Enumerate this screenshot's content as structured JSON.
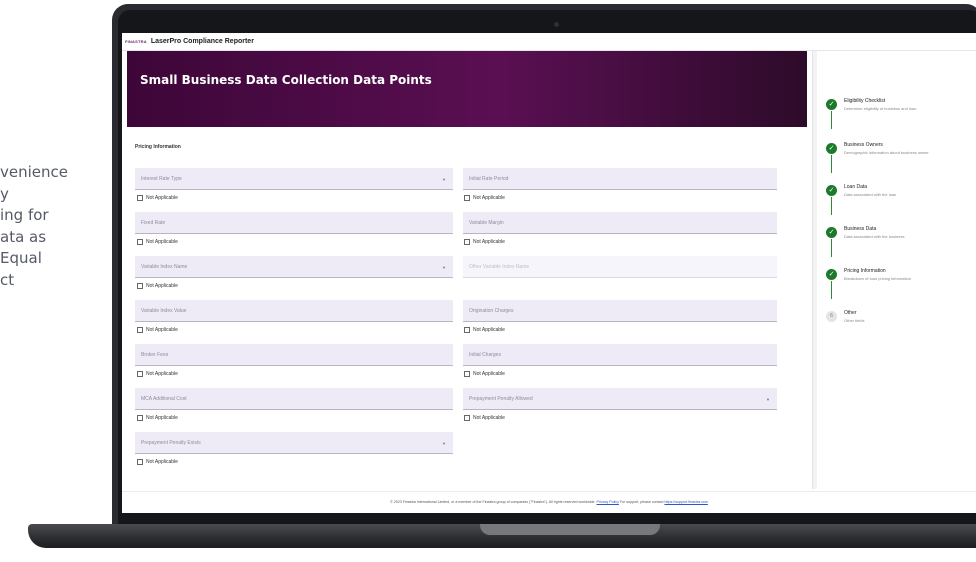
{
  "marketing": {
    "lines": [
      "venience",
      "y",
      "ing for",
      "ata as",
      "Equal",
      "ct"
    ]
  },
  "app": {
    "brand": "FINASTRA",
    "title": "LaserPro Compliance Reporter"
  },
  "page": {
    "heading": "Small Business Data Collection Data Points",
    "section": "Pricing Information"
  },
  "fields": {
    "interest_rate_type": "Interest Rate Type",
    "initial_rate_period": "Initial Rate Period",
    "fixed_rate": "Fixed Rate",
    "variable_margin": "Variable Margin",
    "variable_index_name": "Variable Index Name",
    "other_variable_index_name": "Other Variable Index Name",
    "variable_index_value": "Variable Index Value",
    "origination_charges": "Origination Charges",
    "broker_fees": "Broker Fees",
    "initial_charges": "Initial Charges",
    "mca_additional_cost": "MCA Additional Cost",
    "prepayment_penalty_allowed": "Prepayment Penalty Allowed",
    "prepayment_penalty_exists": "Prepayment Penalty Exists"
  },
  "not_applicable": "Not Applicable",
  "steps": [
    {
      "title": "Eligibility Checklist",
      "desc": "Determine eligibility of business and loan",
      "status": "complete"
    },
    {
      "title": "Business Owners",
      "desc": "Demographic information about business owner",
      "status": "complete"
    },
    {
      "title": "Loan Data",
      "desc": "Data associated with the loan",
      "status": "complete"
    },
    {
      "title": "Business Data",
      "desc": "Data associated with the business",
      "status": "complete"
    },
    {
      "title": "Pricing Information",
      "desc": "Breakdown of loan pricing information",
      "status": "complete"
    },
    {
      "title": "Other",
      "desc": "Other fields",
      "status": "pending",
      "number": "6"
    }
  ],
  "footer": {
    "text": "© 2023 Finastra International Limited, or a member of the Finastra group of companies (\"Finastra\"). All rights reserved worldwide.",
    "privacy": "Privacy Policy",
    "support_text": "For support, please contact",
    "support_link": "https://support.finastra.com"
  },
  "colors": {
    "hero_start": "#3d0638",
    "hero_end": "#5a0f52",
    "step_complete": "#1d7a2c",
    "field_bg": "#eeebf7"
  }
}
